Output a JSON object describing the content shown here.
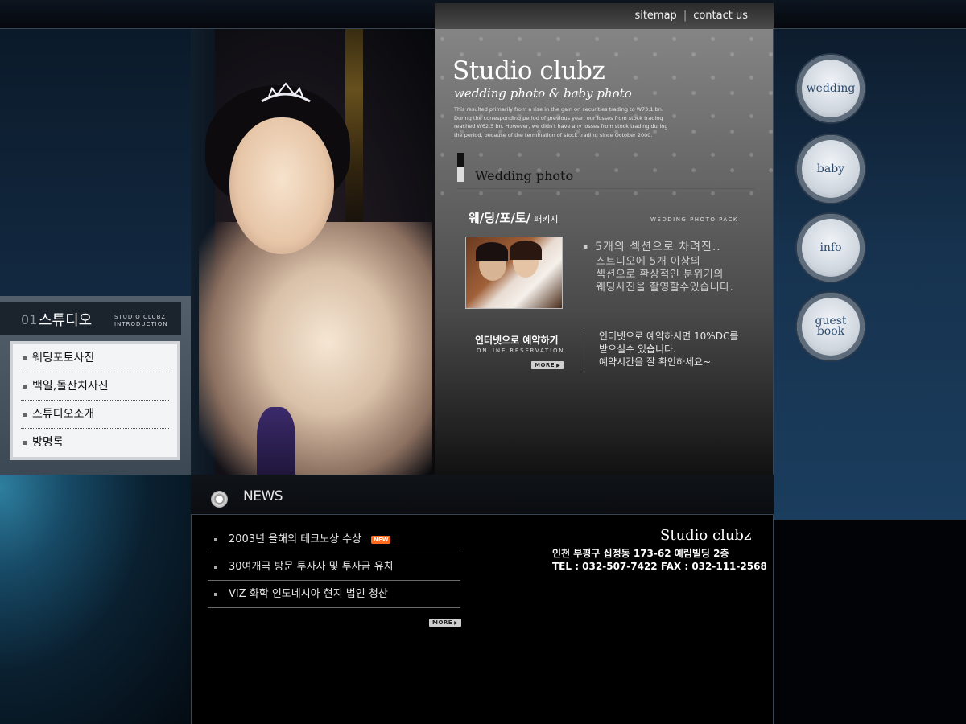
{
  "top_links": {
    "sitemap": "sitemap",
    "contact": "contact us",
    "separator": "|"
  },
  "brand": {
    "name": "Studio clubz",
    "tagline": "wedding photo & baby photo",
    "description": "This resulted primarily from a rise in the gain on securities trading to W73.1 bn. During the corresponding period of previous year, our losses from stock trading reached W62.5 bn. However, we didn't have any losses from stock trading during the period, because of the termination of stock trading since October 2000."
  },
  "section": {
    "title": "Wedding photo"
  },
  "package": {
    "title": "웨/딩/포/토/",
    "title_suffix": "패키지",
    "title_en": "WEDDING PHOTO PACK",
    "heading": "5개의 섹션으로 차려진..",
    "body_lines": [
      "스트디오에 5개 이상의",
      "섹션으로 환상적인 분위기의",
      "웨딩사진을 촬영할수있습니다."
    ]
  },
  "reservation": {
    "title": "인터넷으로 예약하기",
    "title_en": "ONLINE RESERVATION",
    "more": "MORE",
    "body_lines": [
      "인터넷으로 예약하시면 10%DC를",
      "받으실수 있습니다.",
      "예약시간을 잘 확인하세요~"
    ]
  },
  "right_nav": {
    "wedding": "wedding",
    "baby": "baby",
    "info": "info",
    "guest_line1": "guest",
    "guest_line2": "book"
  },
  "studio_menu": {
    "number": "01",
    "title": "스튜디오",
    "title_en_line1": "STUDIO CLUBZ",
    "title_en_line2": "INTRODUCTION",
    "items": [
      "웨딩포토사진",
      "백일,돌잔치사진",
      "스튜디오소개",
      "방명록"
    ]
  },
  "news": {
    "title": "NEWS",
    "new_badge": "NEW",
    "more": "MORE",
    "items": [
      "2003년 올해의 테크노상 수상",
      "30여개국 방문 투자자 및 투자금 유치",
      "VIZ 화학 인도네시아 현지 법인 청산"
    ]
  },
  "footer": {
    "brand": "Studio clubz",
    "address": "인천 부평구 십정동 173-62 예림빌딩 2층",
    "contact": "TEL : 032-507-7422   FAX : 032-111-2568"
  },
  "colors": {
    "accent_new": "#ff6a1e",
    "nav_text": "#2c4a6e"
  }
}
